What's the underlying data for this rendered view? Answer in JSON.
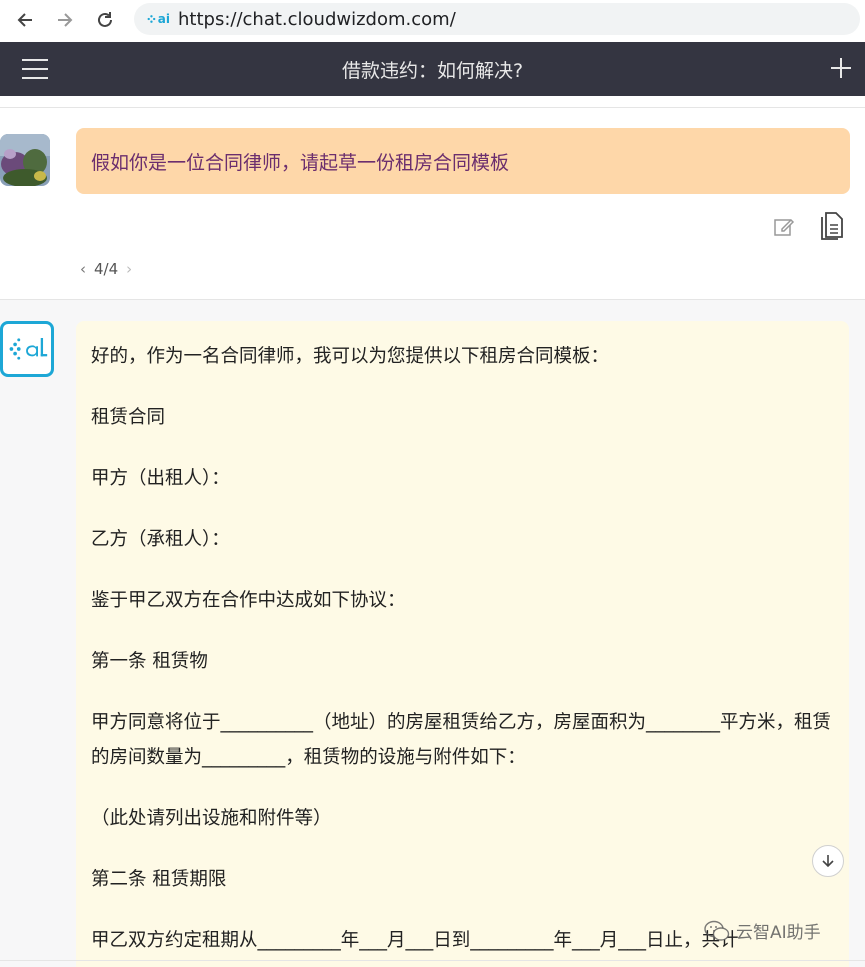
{
  "browser": {
    "url": "https://chat.cloudwizdom.com/",
    "site_icon_text": "ai"
  },
  "header": {
    "title": "借款违约：如何解决?"
  },
  "user_message": {
    "text": "假如你是一位合同律师，请起草一份租房合同模板",
    "pager": "4/4"
  },
  "assistant_message": {
    "paragraphs": [
      "好的，作为一名合同律师，我可以为您提供以下租房合同模板：",
      "租赁合同",
      "甲方（出租人）：",
      "乙方（承租人）：",
      "鉴于甲乙双方在合作中达成如下协议：",
      "第一条 租赁物",
      "甲方同意将位于__________（地址）的房屋租赁给乙方，房屋面积为________平方米，租赁的房间数量为_________，租赁物的设施与附件如下：",
      "（此处请列出设施和附件等）",
      "第二条 租赁期限",
      "甲乙双方约定租期从_________年___月___日到_________年___月___日止，共计"
    ]
  },
  "watermark": {
    "text": "云智AI助手"
  },
  "icons": {
    "back": "arrow-left-icon",
    "forward": "arrow-right-icon",
    "reload": "reload-icon",
    "menu": "hamburger-icon",
    "new_chat": "plus-icon",
    "edit": "edit-icon",
    "copy": "copy-icon",
    "scroll": "arrow-down-icon"
  },
  "colors": {
    "header_bg": "#343541",
    "user_bubble": "#fed7a9",
    "user_text": "#6b2e6e",
    "assistant_bubble": "#fefae6",
    "brand": "#1da7d6"
  }
}
